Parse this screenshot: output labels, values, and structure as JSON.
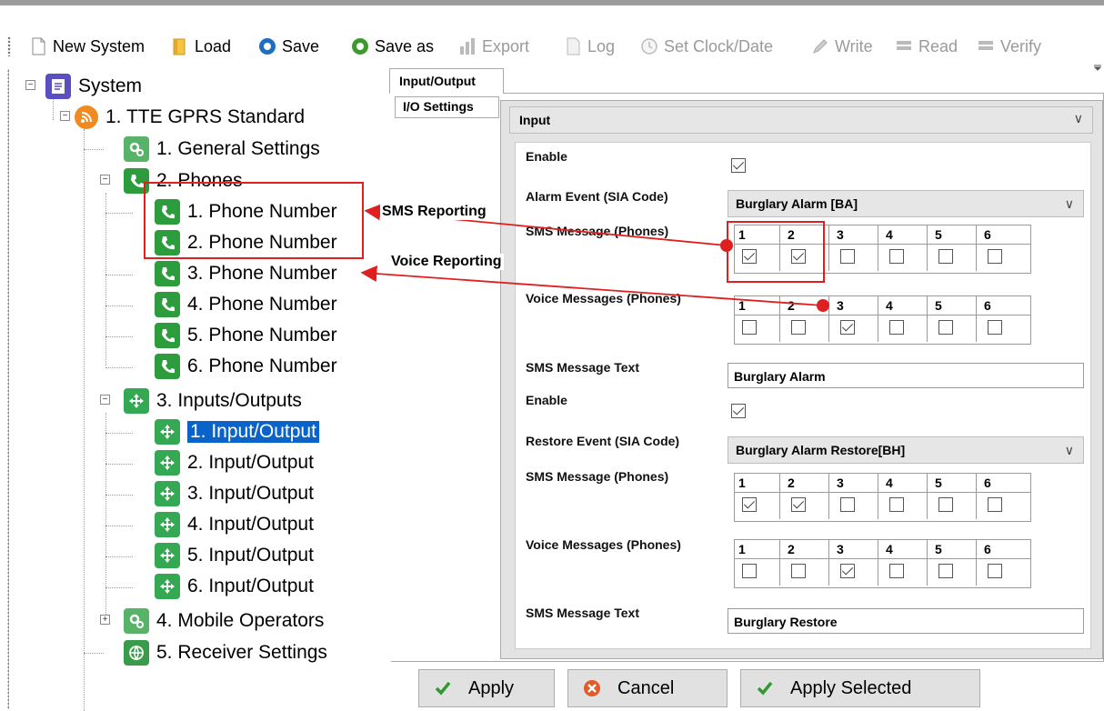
{
  "toolbar": {
    "new_system": "New System",
    "load": "Load",
    "save": "Save",
    "save_as": "Save as",
    "export": "Export",
    "log": "Log",
    "set_clock": "Set Clock/Date",
    "write": "Write",
    "read": "Read",
    "verify": "Verify"
  },
  "tree": {
    "root": "System",
    "device": "1. TTE GPRS Standard",
    "general": "1. General Settings",
    "phones": "2. Phones",
    "phone_items": [
      "1. Phone Number",
      "2. Phone Number",
      "3. Phone Number",
      "4. Phone Number",
      "5. Phone Number",
      "6. Phone Number"
    ],
    "io": "3. Inputs/Outputs",
    "io_items": [
      "1. Input/Output",
      "2. Input/Output",
      "3. Input/Output",
      "4. Input/Output",
      "5. Input/Output",
      "6. Input/Output"
    ],
    "mobile": "4. Mobile Operators",
    "receiver": "5. Receiver Settings"
  },
  "panel": {
    "tab": "Input/Output",
    "vtab": "I/O Settings",
    "type_value": "Input",
    "alarm": {
      "enable_label": "Enable",
      "enabled": true,
      "event_label": "Alarm Event (SIA Code)",
      "event_value": "Burglary Alarm [BA]",
      "sms_label": "SMS Message (Phones)",
      "sms_checked": [
        true,
        true,
        false,
        false,
        false,
        false
      ],
      "voice_label": "Voice Messages (Phones)",
      "voice_checked": [
        false,
        false,
        true,
        false,
        false,
        false
      ],
      "text_label": "SMS Message Text",
      "text_value": "Burglary Alarm"
    },
    "restore": {
      "enable_label": "Enable",
      "enabled": true,
      "event_label": "Restore Event (SIA Code)",
      "event_value": "Burglary Alarm Restore[BH]",
      "sms_label": "SMS Message (Phones)",
      "sms_checked": [
        true,
        true,
        false,
        false,
        false,
        false
      ],
      "voice_label": "Voice Messages (Phones)",
      "voice_checked": [
        false,
        false,
        true,
        false,
        false,
        false
      ],
      "text_label": "SMS Message Text",
      "text_value": "Burglary Restore"
    },
    "phone_headers": [
      "1",
      "2",
      "3",
      "4",
      "5",
      "6"
    ]
  },
  "annotations": {
    "sms": "SMS Reporting",
    "voice": "Voice Reporting",
    "color": "#e02020"
  },
  "buttons": {
    "apply": "Apply",
    "cancel": "Cancel",
    "apply_selected": "Apply Selected"
  }
}
